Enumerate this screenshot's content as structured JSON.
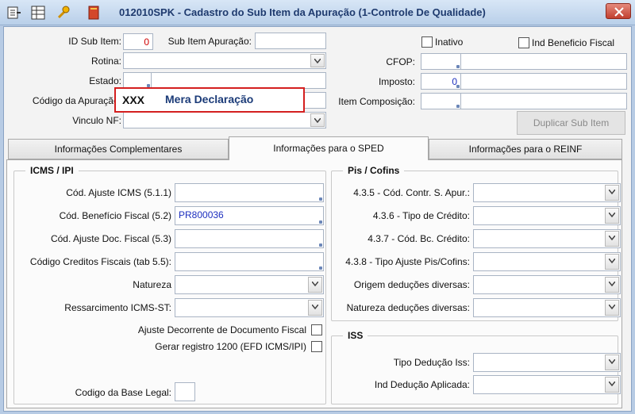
{
  "window": {
    "title": "012010SPK - Cadastro do Sub Item da Apuração (1-Controle De Qualidade)"
  },
  "header": {
    "id_sub_item_label": "ID Sub Item:",
    "id_sub_item_value": "0",
    "sub_item_apuracao_label": "Sub Item Apuração:",
    "sub_item_apuracao_value": "",
    "inativo_label": "Inativo",
    "ind_beneficio_label": "Ind Beneficio Fiscal",
    "rotina_label": "Rotina:",
    "rotina_value": "",
    "cfop_label": "CFOP:",
    "cfop_value": "",
    "estado_label": "Estado:",
    "estado_value": "",
    "imposto_label": "Imposto:",
    "imposto_value": "0",
    "codigo_apuracao_label": "Código da Apuração:",
    "codigo_apuracao_code": "XXX",
    "codigo_apuracao_desc": "Mera Declaração",
    "item_composicao_label": "Item Composição:",
    "item_composicao_value": "",
    "vinculo_nf_label": "Vinculo NF:",
    "vinculo_nf_value": "",
    "duplicar_button": "Duplicar Sub Item"
  },
  "tabs": [
    {
      "label": "Informações Complementares"
    },
    {
      "label": "Informações para o SPED"
    },
    {
      "label": "Informações para o REINF"
    }
  ],
  "icms": {
    "title": "ICMS / IPI",
    "cod_ajuste_icms_label": "Cód. Ajuste ICMS (5.1.1)",
    "cod_ajuste_icms_value": "",
    "cod_beneficio_label": "Cód. Benefício Fiscal (5.2)",
    "cod_beneficio_value": "PR800036",
    "cod_ajuste_doc_label": "Cód. Ajuste Doc. Fiscal (5.3)",
    "cod_ajuste_doc_value": "",
    "codigo_creditos_label": "Código Creditos Fiscais (tab 5.5):",
    "codigo_creditos_value": "",
    "natureza_label": "Natureza",
    "natureza_value": "",
    "ressarcimento_label": "Ressarcimento ICMS-ST:",
    "ressarcimento_value": "",
    "ajuste_decorrente_label": "Ajuste Decorrente de Documento Fiscal",
    "gerar_registro_label": "Gerar registro 1200 (EFD ICMS/IPI)",
    "codigo_base_legal_label": "Codigo da Base Legal:",
    "codigo_base_legal_value": ""
  },
  "pis": {
    "title": "Pis / Cofins",
    "contr_label": "4.3.5 - Cód. Contr. S. Apur.:",
    "tipo_credito_label": "4.3.6 - Tipo de Crédito:",
    "bc_credito_label": "4.3.7 - Cód. Bc. Crédito:",
    "tipo_ajuste_label": "4.3.8 - Tipo Ajuste Pis/Cofins:",
    "origem_label": "Origem deduções diversas:",
    "natureza_label": "Natureza deduções diversas:"
  },
  "iss": {
    "title": "ISS",
    "tipo_deducao_label": "Tipo Dedução Iss:",
    "ind_deducao_label": "Ind Dedução Aplicada:"
  }
}
